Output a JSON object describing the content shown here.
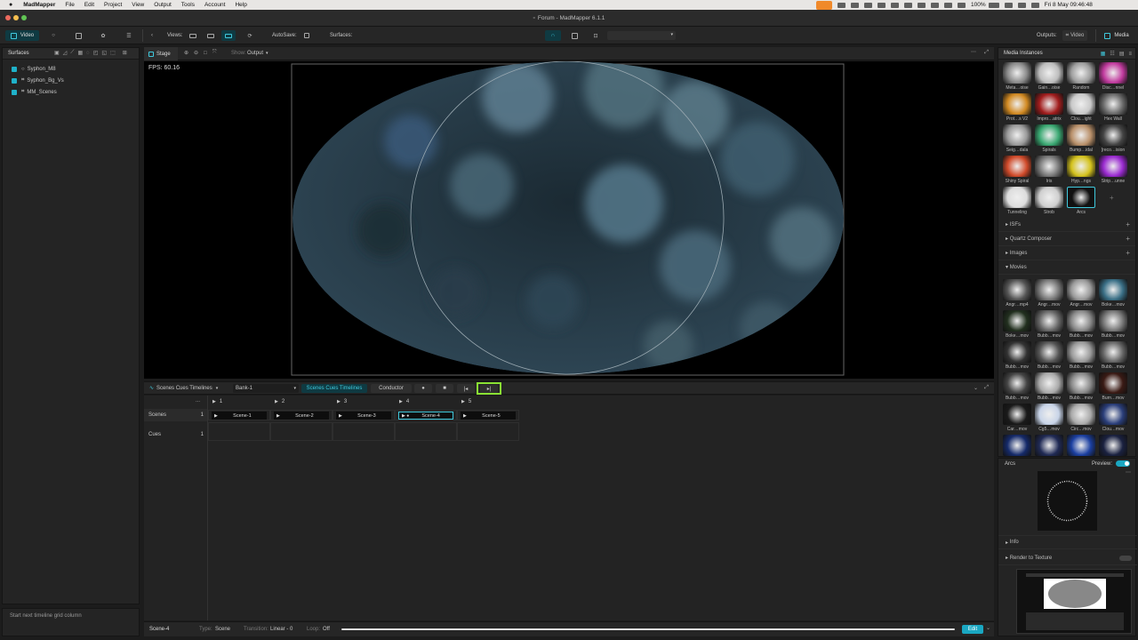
{
  "menubar": {
    "app_name": "MadMapper",
    "items": [
      "File",
      "Edit",
      "Project",
      "View",
      "Output",
      "Tools",
      "Account",
      "Help"
    ],
    "battery": "100%",
    "clock": "Fri 8 May  09:46:48"
  },
  "window": {
    "title": "Forum - MadMapper 6.1.1"
  },
  "toolbar": {
    "video_tab": "Video",
    "views_label": "Views:",
    "autosave_label": "AutoSave:",
    "surfaces_label": "Surfaces:",
    "outputs_label": "Outputs:",
    "outputs_value": "Video",
    "media_tab": "Media"
  },
  "surfaces": {
    "title": "Surfaces",
    "items": [
      {
        "label": "Syphon_M8"
      },
      {
        "label": "Syphon_Bg_Vs"
      },
      {
        "label": "MM_Scenes"
      }
    ],
    "status_tip": "Start next timeline grid column"
  },
  "stage": {
    "tab_label": "Stage",
    "show_label": "Show:",
    "show_value": "Output",
    "fps": "FPS: 60.16"
  },
  "scenes_panel": {
    "mode_label": "Scenes Cues Timelines",
    "bank": "Bank-1",
    "tab_active": "Scenes Cues Timelines",
    "tab_other": "Conductor",
    "dots": "...",
    "columns": [
      "1",
      "2",
      "3",
      "4",
      "5"
    ],
    "row_scenes": "Scenes",
    "row_scenes_num": "1",
    "row_cues": "Cues",
    "row_cues_num": "1",
    "scenes": [
      "Scene-1",
      "Scene-2",
      "Scene-3",
      "Scene-4",
      "Scene-5"
    ],
    "active_scene_index": 3
  },
  "status_bar": {
    "scene_name": "Scene-4",
    "type_label": "Type:",
    "type_value": "Scene",
    "transition_label": "Transition:",
    "transition_value": "Linear - 0",
    "loop_label": "Loop:",
    "loop_value": "Off",
    "edit_button": "Edit"
  },
  "media": {
    "title": "Media Instances",
    "instances": [
      {
        "label": "Meta…oise",
        "color": "#8a8a8a"
      },
      {
        "label": "Gain…oise",
        "color": "#bdbdbd"
      },
      {
        "label": "Random",
        "color": "#9e9e9e"
      },
      {
        "label": "Disc…nnel",
        "color": "#c13a9e"
      },
      {
        "label": "Prot…s V2",
        "color": "#d28a22"
      },
      {
        "label": "Impro…atrix",
        "color": "#a11d1d"
      },
      {
        "label": "Clou…ight",
        "color": "#c9c9c9"
      },
      {
        "label": "Hex Wall",
        "color": "#6a6a6a"
      },
      {
        "label": "Seig…dala",
        "color": "#9a9a9a"
      },
      {
        "label": "Spirals",
        "color": "#3aa872"
      },
      {
        "label": "Bump…idal",
        "color": "#b9906a"
      },
      {
        "label": "[reco…ision",
        "color": "#444444"
      },
      {
        "label": "Shiny Spiral",
        "color": "#d04a2a"
      },
      {
        "label": "Iris",
        "color": "#777777"
      },
      {
        "label": "Hyp…ngs",
        "color": "#d4c21d"
      },
      {
        "label": "Strip…unne",
        "color": "#9a2ad0"
      },
      {
        "label": "Tunneling",
        "color": "#dddddd"
      },
      {
        "label": "Strob",
        "color": "#cfcfcf"
      },
      {
        "label": "Arcs",
        "color": "#111111"
      }
    ],
    "sections": [
      "ISFs",
      "Quartz Composer",
      "Images",
      "Movies"
    ],
    "movies": [
      {
        "label": "Angr…mp4",
        "color": "#555"
      },
      {
        "label": "Angr…mov",
        "color": "#777"
      },
      {
        "label": "Angr…mov",
        "color": "#999"
      },
      {
        "label": "Boke…mov",
        "color": "#3a6f86"
      },
      {
        "label": "Boke…mov",
        "color": "#22301f"
      },
      {
        "label": "Bubb…mov",
        "color": "#666"
      },
      {
        "label": "Bubb…mov",
        "color": "#888"
      },
      {
        "label": "Bubb…mov",
        "color": "#777"
      },
      {
        "label": "Bubb…mov",
        "color": "#333"
      },
      {
        "label": "Bubb…mov",
        "color": "#555"
      },
      {
        "label": "Bubb…mov",
        "color": "#999"
      },
      {
        "label": "Bubb…mov",
        "color": "#666"
      },
      {
        "label": "Bubb…mov",
        "color": "#444"
      },
      {
        "label": "Bubb…mov",
        "color": "#aaa"
      },
      {
        "label": "Bubb…mov",
        "color": "#888"
      },
      {
        "label": "Burn…mov",
        "color": "#3a1a14"
      },
      {
        "label": "Car…mov",
        "color": "#1a1a1a"
      },
      {
        "label": "Cg5…mov",
        "color": "#c8d4e8"
      },
      {
        "label": "Circ…mov",
        "color": "#aaaaaa"
      },
      {
        "label": "Clou…mov",
        "color": "#2a3e7a"
      },
      {
        "label": "",
        "color": "#152a6a"
      },
      {
        "label": "",
        "color": "#202a55"
      },
      {
        "label": "",
        "color": "#1b3fa0"
      },
      {
        "label": "",
        "color": "#1a2140"
      }
    ],
    "preview_name": "Arcs",
    "preview_label": "Preview:",
    "info_label": "Info",
    "render_label": "Render to Texture"
  },
  "colors": {
    "accent": "#3fc9dd",
    "highlight": "#8ae234"
  }
}
